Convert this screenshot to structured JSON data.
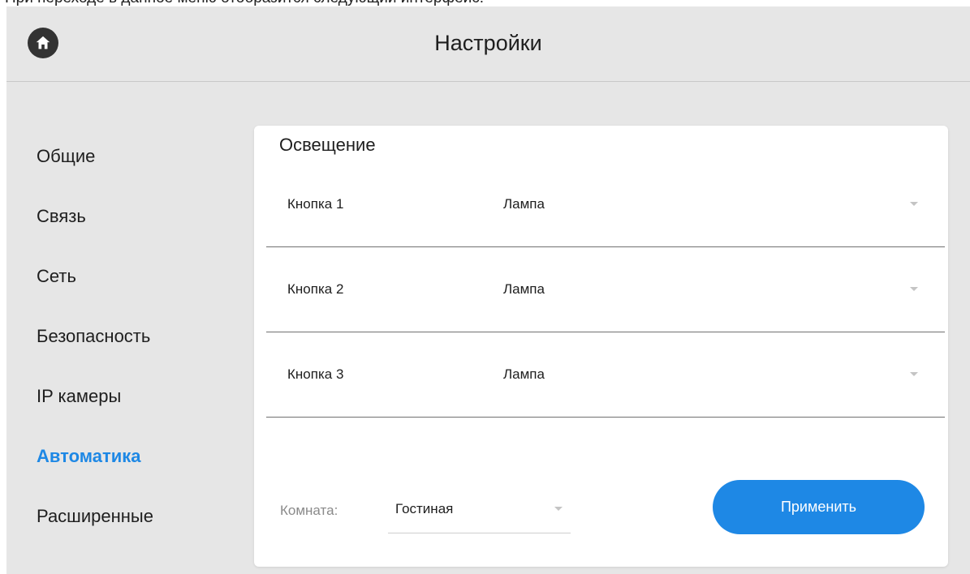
{
  "caption": "При переходе в данное меню отобразится следующий интерфейс:",
  "header": {
    "title": "Настройки",
    "home_icon": "home-icon"
  },
  "sidebar": {
    "items": [
      {
        "label": "Общие",
        "active": false
      },
      {
        "label": "Связь",
        "active": false
      },
      {
        "label": "Сеть",
        "active": false
      },
      {
        "label": "Безопасность",
        "active": false
      },
      {
        "label": "IP камеры",
        "active": false
      },
      {
        "label": "Автоматика",
        "active": true
      },
      {
        "label": "Расширенные",
        "active": false
      }
    ]
  },
  "main": {
    "section_title": "Освещение",
    "rows": [
      {
        "label": "Кнопка 1",
        "value": "Лампа"
      },
      {
        "label": "Кнопка 2",
        "value": "Лампа"
      },
      {
        "label": "Кнопка 3",
        "value": "Лампа"
      }
    ],
    "room": {
      "label": "Комната:",
      "value": "Гостиная"
    },
    "apply_label": "Применить"
  },
  "colors": {
    "accent": "#1e88e5",
    "background": "#e6e6e6",
    "card": "#ffffff",
    "text": "#1e1e1e",
    "muted_text": "#8a8a8a",
    "home_button": "#333333"
  }
}
